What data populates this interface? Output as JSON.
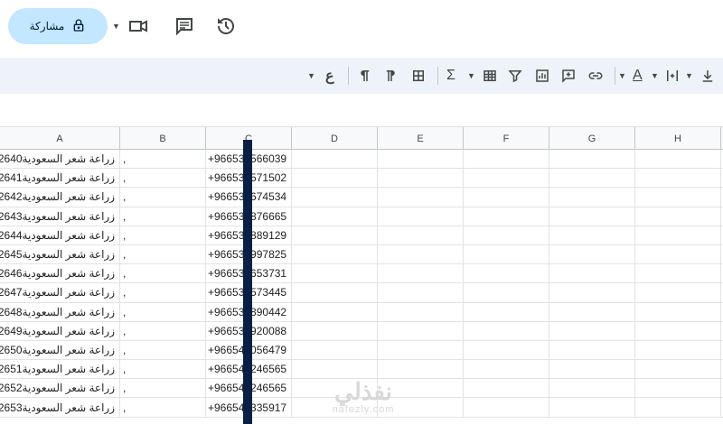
{
  "header": {
    "share_label": "مشاركة"
  },
  "toolbar": {
    "text_tool_glyph": "ع",
    "sum_glyph": "Σ",
    "text_color_glyph": "A"
  },
  "columns": [
    "A",
    "B",
    "C",
    "D",
    "E",
    "F",
    "G",
    "H"
  ],
  "rows": [
    {
      "a": "زراعة شعر السعودية2640",
      "b": ",",
      "c": "+966532566039"
    },
    {
      "a": "زراعة شعر السعودية2641",
      "b": ",",
      "c": "+966533571502"
    },
    {
      "a": "زراعة شعر السعودية2642",
      "b": ",",
      "c": "+966533674534"
    },
    {
      "a": "زراعة شعر السعودية2643",
      "b": ",",
      "c": "+966533876665"
    },
    {
      "a": "زراعة شعر السعودية2644",
      "b": ",",
      "c": "+966533889129"
    },
    {
      "a": "زراعة شعر السعودية2645",
      "b": ",",
      "c": "+966533997825"
    },
    {
      "a": "زراعة شعر السعودية2646",
      "b": ",",
      "c": "+966533653731"
    },
    {
      "a": "زراعة شعر السعودية2647",
      "b": ",",
      "c": "+966533573445"
    },
    {
      "a": "زراعة شعر السعودية2648",
      "b": ",",
      "c": "+966533890442"
    },
    {
      "a": "زراعة شعر السعودية2649",
      "b": ",",
      "c": "+966533920088"
    },
    {
      "a": "زراعة شعر السعودية2650",
      "b": ",",
      "c": "+966540056479"
    },
    {
      "a": "زراعة شعر السعودية2651",
      "b": ",",
      "c": "+966540246565"
    },
    {
      "a": "زراعة شعر السعودية2652",
      "b": ",",
      "c": "+966540246565"
    },
    {
      "a": "زراعة شعر السعودية2653",
      "b": ",",
      "c": "+966540335917"
    }
  ],
  "watermark": {
    "main": "نفذلي",
    "sub": "nafezly.com"
  },
  "colors": {
    "share_bg": "#c2e7ff",
    "toolbar_bg": "#eef2f9",
    "redaction": "#0a1f44"
  }
}
